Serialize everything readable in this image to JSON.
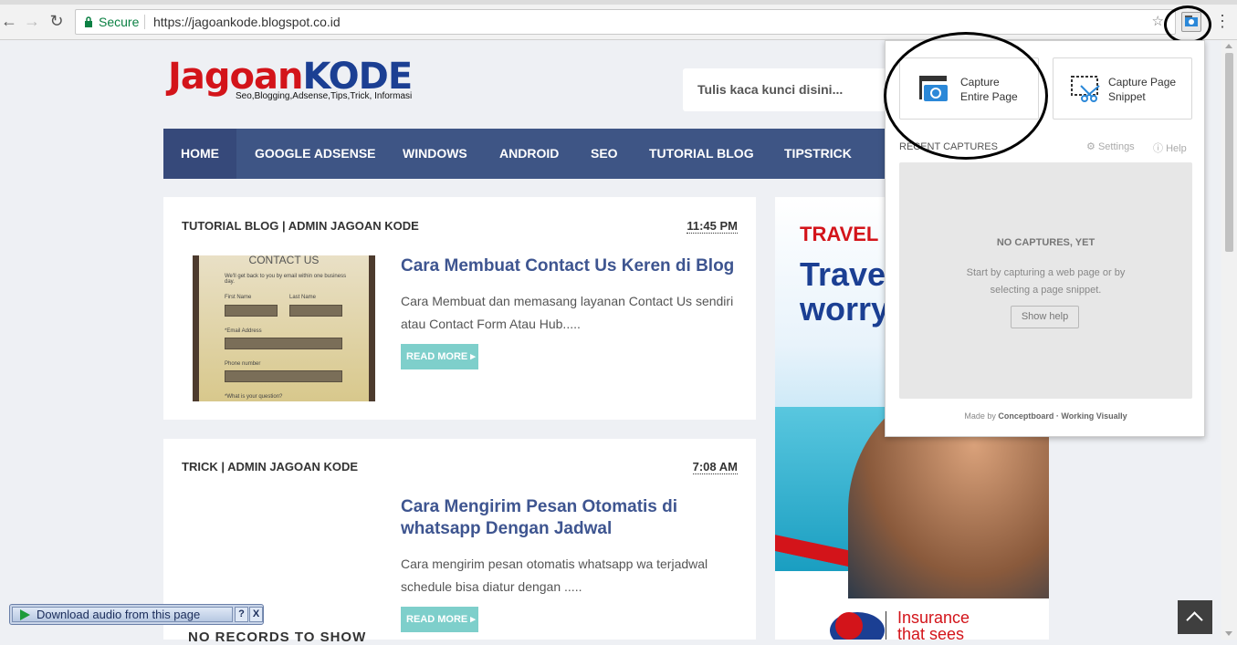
{
  "browser": {
    "secure_label": "Secure",
    "url": "https://jagoankode.blogspot.co.id"
  },
  "site": {
    "logo_part1": "Jagoan",
    "logo_part2": "KODE",
    "tagline": "Seo,Blogging,Adsense,Tips,Trick, Informasi",
    "search_placeholder": "Tulis kaca kunci disini...",
    "nav": [
      "HOME",
      "GOOGLE ADSENSE",
      "WINDOWS",
      "ANDROID",
      "SEO",
      "TUTORIAL BLOG",
      "TIPSTRICK"
    ]
  },
  "posts": [
    {
      "meta": "TUTORIAL BLOG | ADMIN JAGOAN KODE",
      "time": "11:45 PM",
      "title": "Cara Membuat Contact Us Keren di Blog",
      "excerpt": "Cara Membuat dan memasang layanan Contact Us sendiri atau Contact Form Atau Hub.....",
      "read_more": "READ MORE",
      "thumb": {
        "heading": "CONTACT US",
        "intro": "We'll get back to you by email within one business day.",
        "first_name": "First Name",
        "last_name": "Last Name",
        "email": "*Email Address",
        "phone": "Phone number",
        "question": "*What is your question?"
      }
    },
    {
      "meta": "TRICK | ADMIN JAGOAN KODE",
      "time": "7:08 AM",
      "title": "Cara Mengirim Pesan Otomatis di whatsapp Dengan Jadwal",
      "excerpt": "Cara mengirim pesan otomatis whatsapp wa terjadwal schedule bisa diatur dengan .....",
      "read_more": "READ MORE"
    }
  ],
  "ad": {
    "headline": "TRAVEL I",
    "big_line1": "Travel",
    "big_line2": "worry",
    "insurance_line1": "Insurance",
    "insurance_line2": "that sees"
  },
  "popup": {
    "capture_entire": "Capture Entire Page",
    "capture_snippet": "Capture Page Snippet",
    "recent_captures": "RECENT CAPTURES",
    "settings": "Settings",
    "help": "Help",
    "no_captures": "NO CAPTURES, YET",
    "instructions": "Start by capturing a web page or by selecting a page snippet.",
    "show_help": "Show help",
    "footer_made_by": "Made by",
    "footer_brand": "Conceptboard · Working Visually"
  },
  "download_bar": {
    "label": "Download audio from this page",
    "help": "?",
    "close": "X"
  },
  "partial_text": "NO RECORDS TO SHOW"
}
